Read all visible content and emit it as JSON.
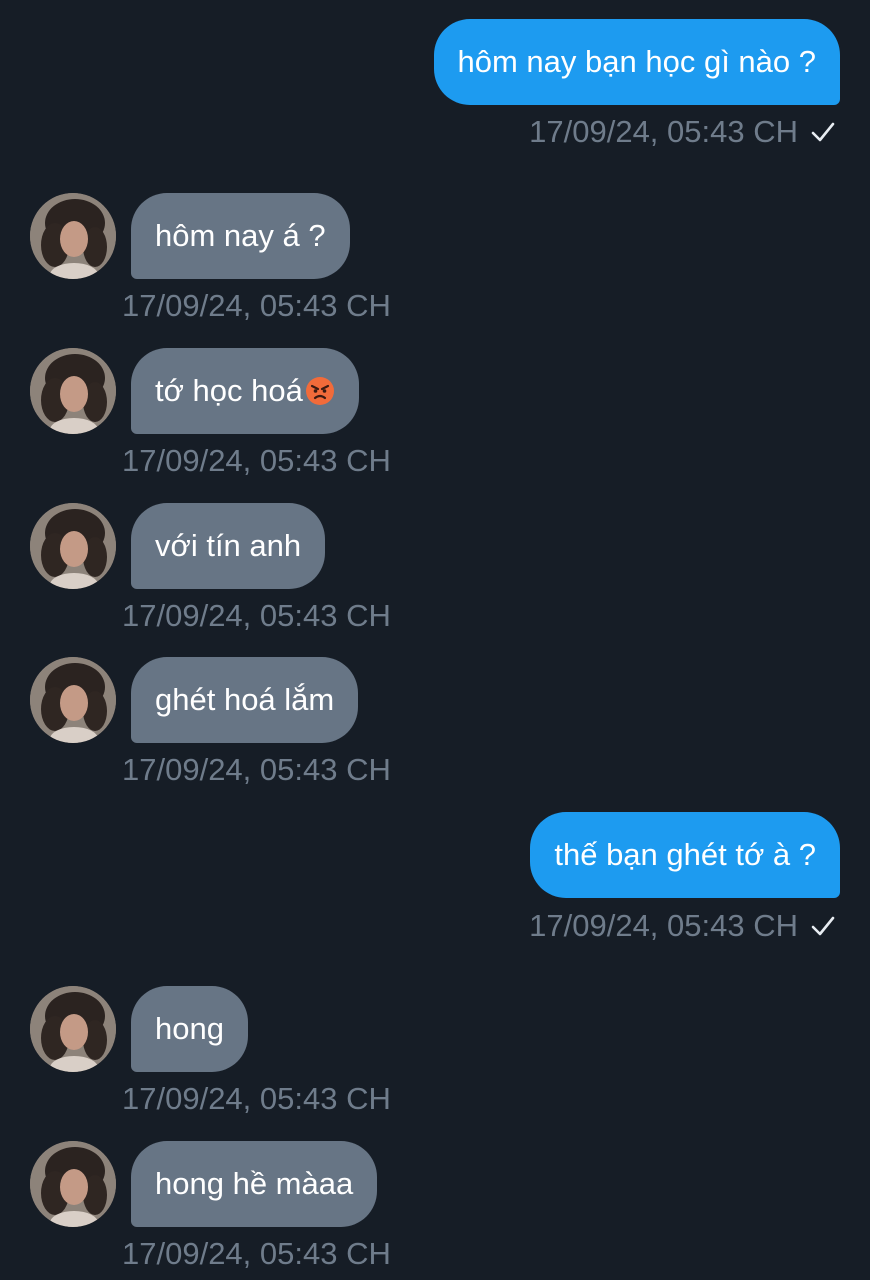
{
  "messages": [
    {
      "direction": "out",
      "text": "hôm nay bạn học gì nào ?",
      "time": "17/09/24, 05:43 CH",
      "status_icon": "check-icon"
    },
    {
      "direction": "in",
      "text": "hôm nay á ?",
      "time": "17/09/24, 05:43 CH"
    },
    {
      "direction": "in",
      "text": "tớ học hoá",
      "emoji": "angry-face-emoji",
      "time": "17/09/24, 05:43 CH"
    },
    {
      "direction": "in",
      "text": "với tín anh",
      "time": "17/09/24, 05:43 CH"
    },
    {
      "direction": "in",
      "text": "ghét hoá lắm",
      "time": "17/09/24, 05:43 CH"
    },
    {
      "direction": "out",
      "text": "thế bạn ghét tớ à ?",
      "time": "17/09/24, 05:43 CH",
      "status_icon": "check-icon"
    },
    {
      "direction": "in",
      "text": "hong",
      "time": "17/09/24, 05:43 CH"
    },
    {
      "direction": "in",
      "text": "hong hề màaa",
      "time": "17/09/24, 05:43 CH"
    }
  ],
  "colors": {
    "background": "#161d26",
    "outgoing_bubble": "#1d9bf0",
    "incoming_bubble": "#677585",
    "timestamp": "#6f7c8b"
  }
}
